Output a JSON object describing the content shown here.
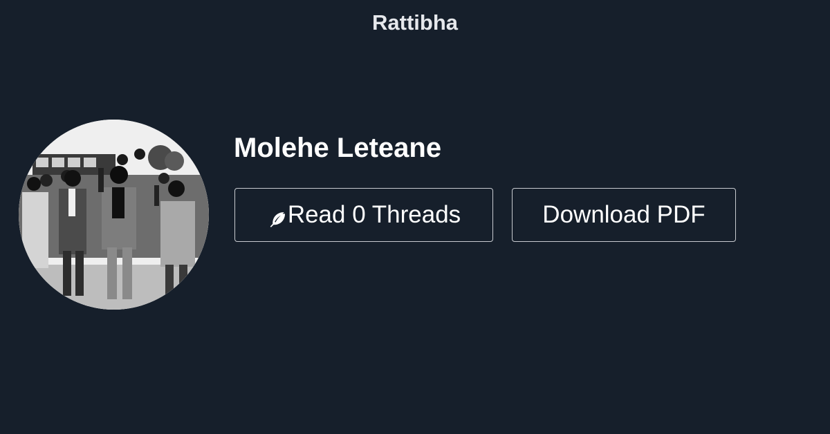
{
  "site": {
    "brand": "Rattibha"
  },
  "profile": {
    "name": "Molehe Leteane",
    "avatar_description_icon": "profile-photo"
  },
  "actions": {
    "read_label": "Read 0 Threads",
    "read_icon": "feather-icon",
    "download_label": "Download PDF"
  },
  "colors": {
    "background": "#161f2b",
    "text": "#ffffff",
    "button_border": "#c9ccd1"
  }
}
